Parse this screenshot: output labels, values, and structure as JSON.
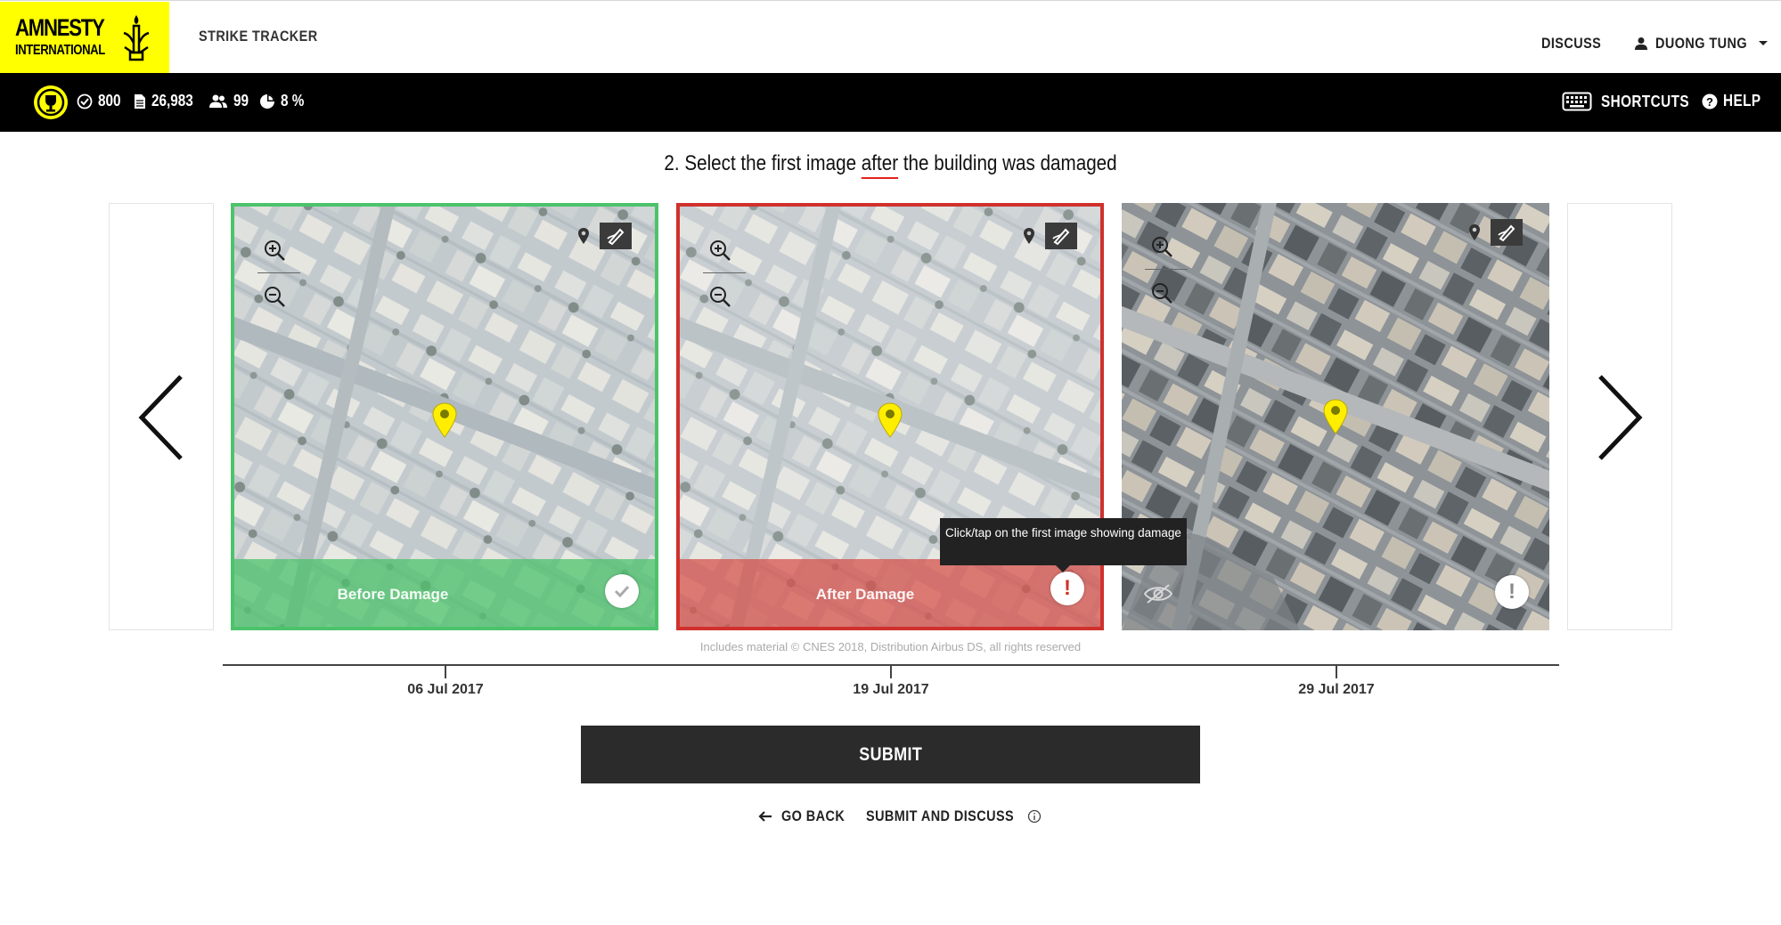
{
  "header": {
    "logo_line1": "AMNESTY",
    "logo_line2": "INTERNATIONAL",
    "app_title": "STRIKE TRACKER",
    "discuss_label": "DISCUSS",
    "user_name": "DUONG TUNG",
    "brand_color": "#ffff00"
  },
  "stats": {
    "completed": "800",
    "images": "26,983",
    "users": "99",
    "progress": "8 %",
    "shortcuts_label": "SHORTCUTS",
    "help_label": "HELP"
  },
  "question": {
    "prefix": "2. Select the first image ",
    "highlight": "after",
    "suffix": " the building was damaged"
  },
  "tiles": [
    {
      "date": "06 Jul 2017",
      "label": "Before Damage",
      "state": "before",
      "status_icon": "check-icon",
      "border_color": "#4cc36b"
    },
    {
      "date": "19 Jul 2017",
      "label": "After Damage",
      "state": "after",
      "status_icon": "exclamation-icon",
      "border_color": "#d0312d"
    },
    {
      "date": "29 Jul 2017",
      "label": "",
      "state": "unselected",
      "status_icon": "exclamation-icon",
      "extra_icon": "hidden-eye-icon"
    }
  ],
  "tooltip": "Click/tap on the first image showing damage",
  "copyright": "Includes material © CNES 2018, Distribution Airbus DS, all rights reserved",
  "actions": {
    "submit": "SUBMIT",
    "go_back": "GO BACK",
    "submit_and_discuss": "SUBMIT AND DISCUSS"
  }
}
